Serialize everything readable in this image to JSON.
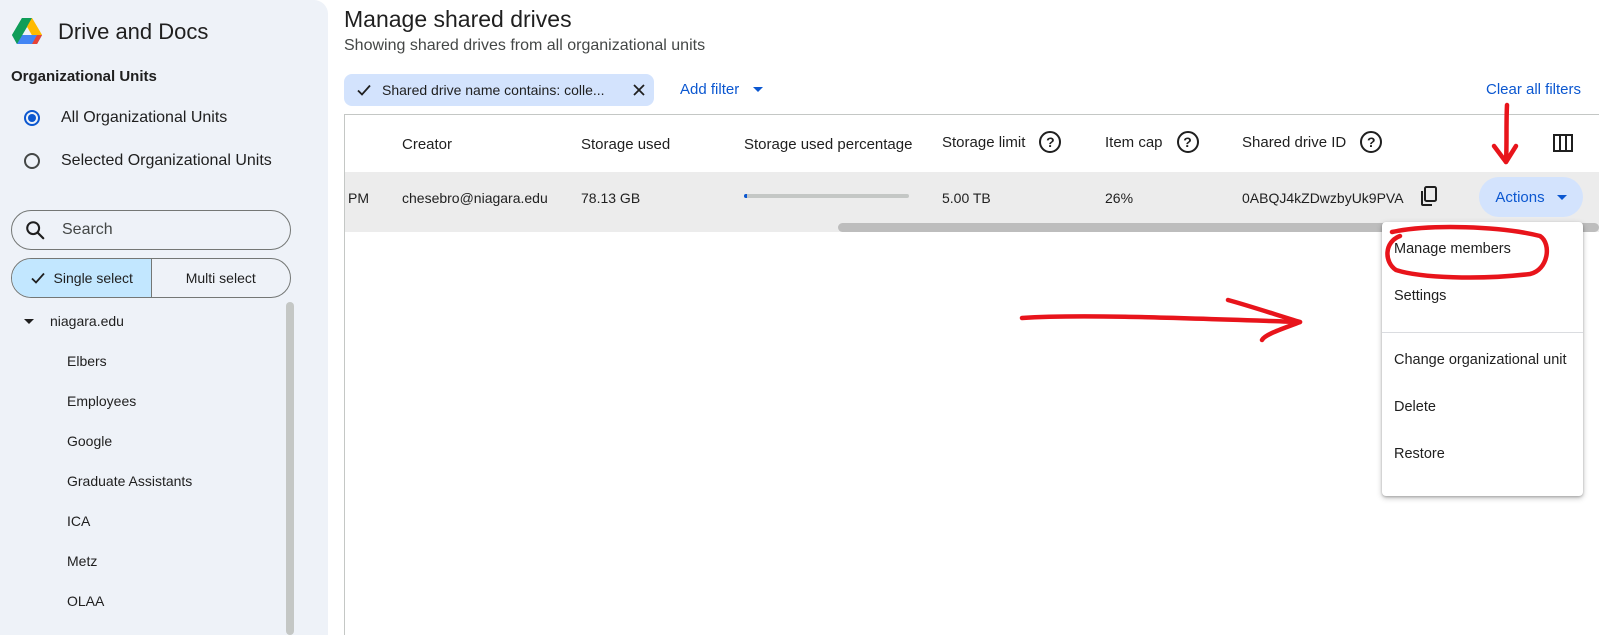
{
  "app": {
    "title": "Drive and Docs"
  },
  "sidebar": {
    "heading": "Organizational Units",
    "radio_all": "All Organizational Units",
    "radio_selected": "Selected Organizational Units",
    "search_placeholder": "Search",
    "single_select": "Single select",
    "multi_select": "Multi select",
    "tree_root": "niagara.edu",
    "tree_children": [
      "Elbers",
      "Employees",
      "Google",
      "Graduate Assistants",
      "ICA",
      "Metz",
      "OLAA"
    ]
  },
  "main": {
    "title": "Manage shared drives",
    "subtitle": "Showing shared drives from all organizational units",
    "filter_chip": "Shared drive name contains: colle...",
    "add_filter": "Add filter",
    "clear_filters": "Clear all filters",
    "columns": {
      "creator": "Creator",
      "storage_used": "Storage used",
      "storage_pct": "Storage used percentage",
      "storage_limit": "Storage limit",
      "item_cap": "Item cap",
      "drive_id": "Shared drive ID"
    },
    "row": {
      "time_fragment": "PM",
      "creator": "chesebro@niagara.edu",
      "storage_used": "78.13 GB",
      "storage_pct_fraction": 0.016,
      "storage_limit": "5.00 TB",
      "item_cap": "26%",
      "drive_id": "0ABQJ4kZDwzbyUk9PVA"
    },
    "actions_label": "Actions"
  },
  "menu": {
    "items": [
      "Manage members",
      "Settings",
      "Change organizational unit",
      "Delete",
      "Restore"
    ]
  },
  "colors": {
    "accent": "#0b57d0",
    "chip_bg": "#d3e3fd",
    "sidebar_bg": "#eef2f8",
    "annotation": "#e8141b"
  }
}
